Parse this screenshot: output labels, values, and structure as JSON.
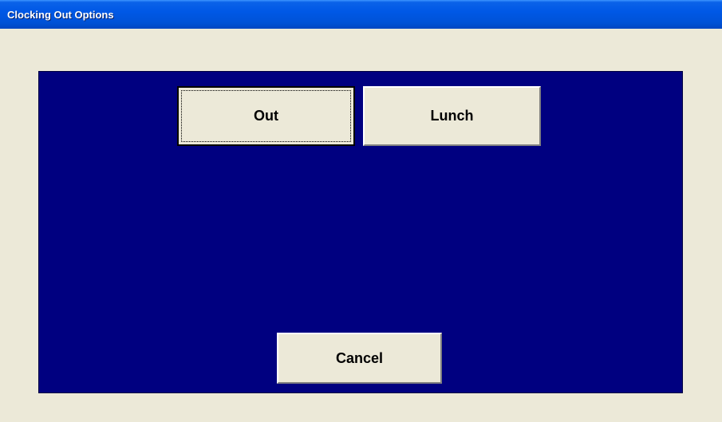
{
  "window": {
    "title": "Clocking Out Options"
  },
  "buttons": {
    "out_label": "Out",
    "lunch_label": "Lunch",
    "cancel_label": "Cancel"
  },
  "colors": {
    "panel_background": "#000080",
    "window_background": "#ece9d8",
    "titlebar": "#0058e6"
  }
}
